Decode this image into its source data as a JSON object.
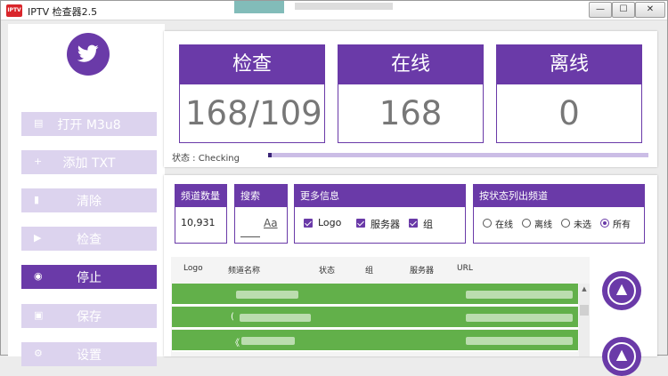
{
  "window": {
    "title": "IPTV 检查器2.5",
    "app_icon_text": "IPTV",
    "controls": {
      "minimize": "—",
      "maximize": "☐",
      "close": "✕"
    }
  },
  "sidebar": {
    "avatar_icon": "twitter-bird-icon",
    "buttons": [
      {
        "label": "打开 M3u8",
        "icon": "file-icon",
        "glyph": "▤",
        "active": false
      },
      {
        "label": "添加 TXT",
        "icon": "plus-icon",
        "glyph": "+",
        "active": false
      },
      {
        "label": "清除",
        "icon": "trash-icon",
        "glyph": "▮",
        "active": false
      },
      {
        "label": "检查",
        "icon": "play-icon",
        "glyph": "▶",
        "active": false
      },
      {
        "label": "停止",
        "icon": "stop-icon",
        "glyph": "◉",
        "active": true
      },
      {
        "label": "保存",
        "icon": "save-icon",
        "glyph": "▣",
        "active": false
      },
      {
        "label": "设置",
        "icon": "gear-icon",
        "glyph": "⚙",
        "active": false
      }
    ]
  },
  "stats": {
    "check": {
      "label": "检查",
      "value": "168/109"
    },
    "online": {
      "label": "在线",
      "value": "168"
    },
    "offline": {
      "label": "离线",
      "value": "0"
    },
    "status_text": "状态 : Checking",
    "progress": 0.01
  },
  "filters": {
    "channel_count": {
      "label": "频道数量",
      "value": "10,931"
    },
    "search": {
      "label": "搜索",
      "placeholder": "Aa"
    },
    "more_info": {
      "label": "更多信息",
      "options": [
        {
          "label": "Logo",
          "checked": true
        },
        {
          "label": "服务器",
          "checked": true
        },
        {
          "label": "组",
          "checked": true
        }
      ]
    },
    "status_filter": {
      "label": "按状态列出频道",
      "options": [
        {
          "label": "在线",
          "checked": false
        },
        {
          "label": "离线",
          "checked": false
        },
        {
          "label": "未选",
          "checked": false
        },
        {
          "label": "所有",
          "checked": true
        }
      ]
    }
  },
  "table": {
    "columns": [
      "Logo",
      "频道名称",
      "状态",
      "组",
      "服务器",
      "URL"
    ],
    "rows": [
      {
        "name": ""
      },
      {
        "name": "("
      },
      {
        "name": "《"
      }
    ],
    "scroll_up": "▲"
  },
  "actions": {
    "scroll_up_icon": "arrow-up-circle-icon",
    "arrow_glyph": "▲"
  },
  "colors": {
    "accent": "#6a3aa8",
    "accent_light": "#dcd3ee",
    "row_online": "#62b04a"
  }
}
